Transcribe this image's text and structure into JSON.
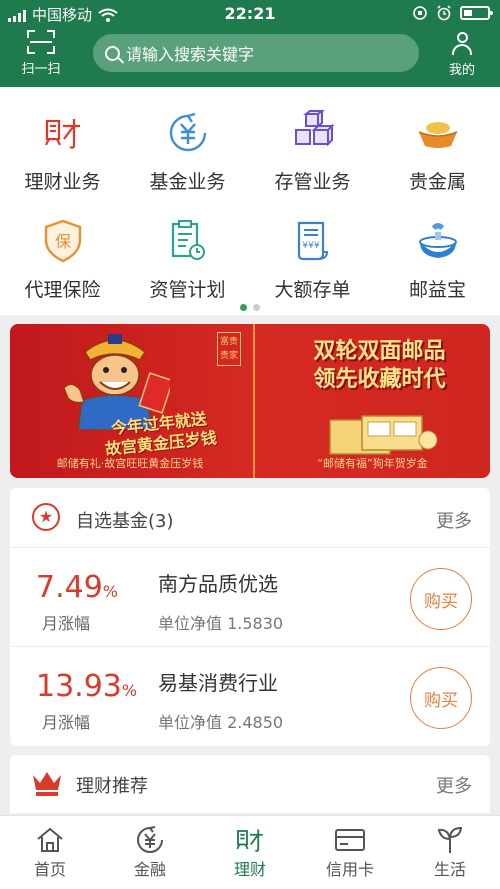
{
  "status": {
    "carrier": "中国移动",
    "time": "22:21"
  },
  "header": {
    "scan_label": "扫一扫",
    "search_placeholder": "请输入搜索关键字",
    "mine_label": "我的"
  },
  "services": [
    {
      "label": "理财业务",
      "icon": "wealth-icon"
    },
    {
      "label": "基金业务",
      "icon": "fund-icon"
    },
    {
      "label": "存管业务",
      "icon": "custody-boxes-icon"
    },
    {
      "label": "贵金属",
      "icon": "gold-ingot-icon"
    },
    {
      "label": "代理保险",
      "icon": "insurance-shield-icon"
    },
    {
      "label": "资管计划",
      "icon": "asset-plan-icon"
    },
    {
      "label": "大额存单",
      "icon": "certificate-icon"
    },
    {
      "label": "邮益宝",
      "icon": "yiyibao-icon"
    }
  ],
  "banner": {
    "left_title": "今年过年就送\n故宫黄金压岁钱",
    "left_sub": "邮储有礼·故宫旺旺黄金压岁钱",
    "left_seal": "富贵\n贵家",
    "right_title": "双轮双面邮品\n领先收藏时代",
    "right_sub": "“邮储有福”狗年贺岁金"
  },
  "fund_section": {
    "title": "自选基金(3)",
    "more": "更多",
    "funds": [
      {
        "pct": "7.49",
        "unit": "%",
        "pct_label": "月涨幅",
        "name": "南方品质优选",
        "nav": "单位净值 1.5830",
        "buy": "购买"
      },
      {
        "pct": "13.93",
        "unit": "%",
        "pct_label": "月涨幅",
        "name": "易基消费行业",
        "nav": "单位净值 2.4850",
        "buy": "购买"
      }
    ]
  },
  "recommend_section": {
    "title": "理财推荐",
    "more": "更多"
  },
  "tabs": [
    {
      "label": "首页",
      "icon": "home-icon"
    },
    {
      "label": "金融",
      "icon": "finance-yen-icon"
    },
    {
      "label": "理财",
      "icon": "wealth-tab-icon",
      "active": true
    },
    {
      "label": "信用卡",
      "icon": "credit-card-icon"
    },
    {
      "label": "生活",
      "icon": "life-sprout-icon"
    }
  ],
  "colors": {
    "brand_green": "#1f7a4d",
    "accent_red": "#d83a2c",
    "buy_orange": "#e5803f"
  }
}
